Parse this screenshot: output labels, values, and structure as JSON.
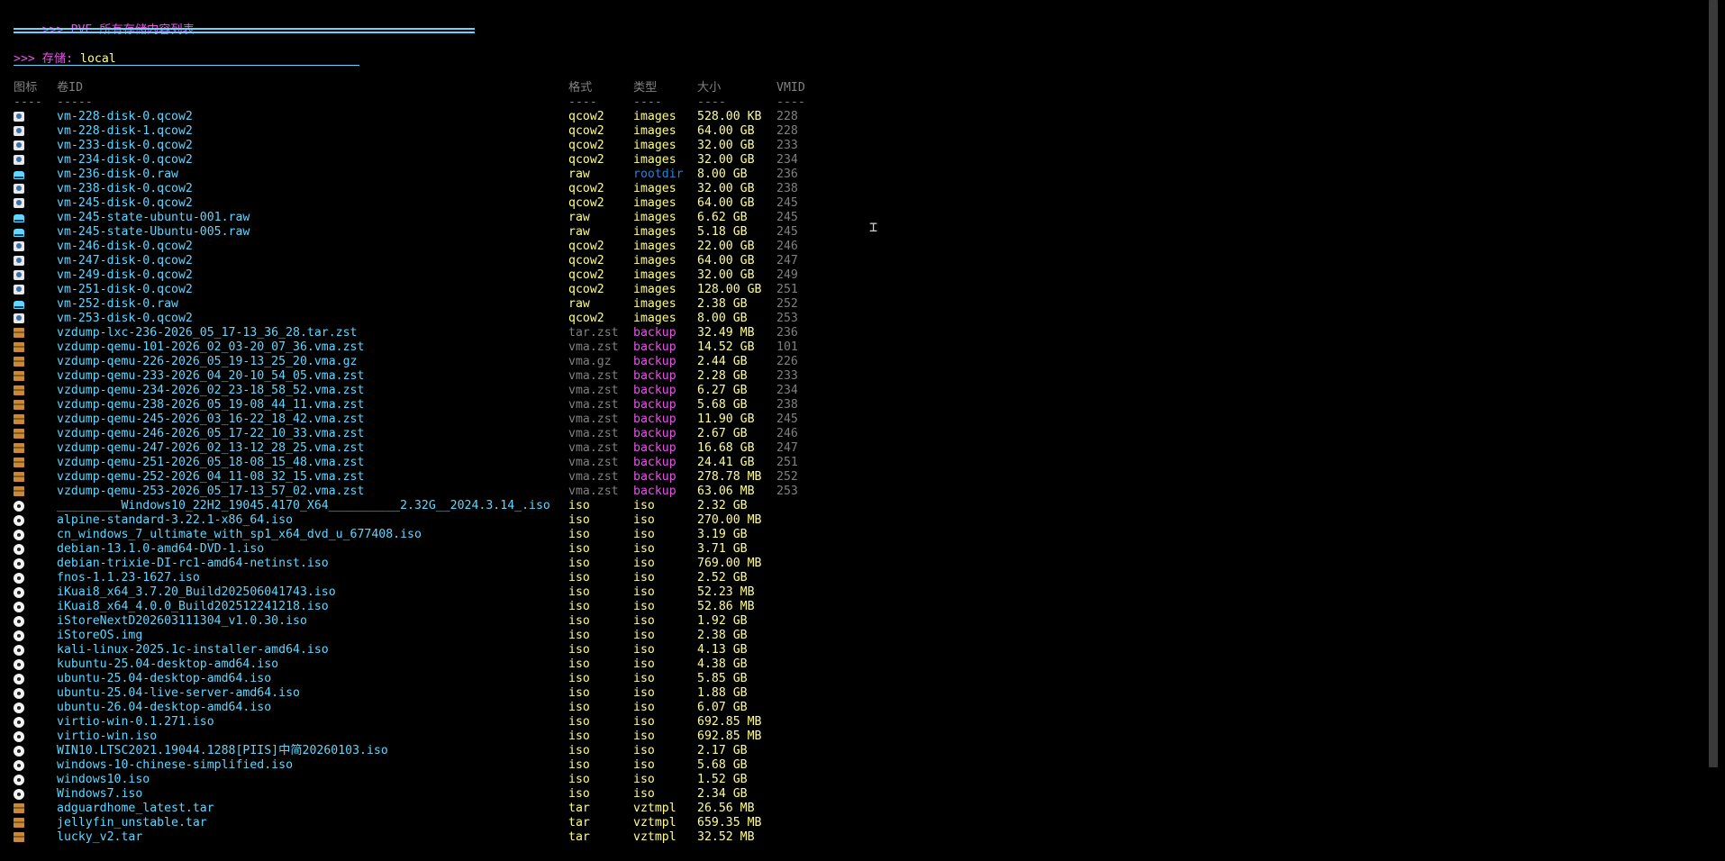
{
  "title": ">>> PVE 所有存储内容列表",
  "separator_long": "===========================================================",
  "storage_heading": ">>> 存储: ",
  "storage_name": "local",
  "columns": {
    "icon": "图标",
    "volid": "卷ID",
    "format": "格式",
    "type": "类型",
    "size": "大小",
    "vmid": "VMID"
  },
  "column_underlines": {
    "icon": "----",
    "volid": "-----",
    "format": "----",
    "type": "----",
    "size": "----",
    "vmid": "----"
  },
  "colors": {
    "magenta": "#e356e3",
    "cyan": "#5fd7ff",
    "yellow": "#ffff87",
    "grey": "#808080",
    "rootdir_blue": "#2f7fd4",
    "background": "#000000"
  },
  "rows": [
    {
      "icon": "disk-icon",
      "volid": "vm-228-disk-0.qcow2",
      "format": "qcow2",
      "type": "images",
      "size": "528.00 KB",
      "vmid": "228"
    },
    {
      "icon": "disk-icon",
      "volid": "vm-228-disk-1.qcow2",
      "format": "qcow2",
      "type": "images",
      "size": "64.00 GB",
      "vmid": "228"
    },
    {
      "icon": "disk-icon",
      "volid": "vm-233-disk-0.qcow2",
      "format": "qcow2",
      "type": "images",
      "size": "32.00 GB",
      "vmid": "233"
    },
    {
      "icon": "disk-icon",
      "volid": "vm-234-disk-0.qcow2",
      "format": "qcow2",
      "type": "images",
      "size": "32.00 GB",
      "vmid": "234"
    },
    {
      "icon": "raw-icon",
      "volid": "vm-236-disk-0.raw",
      "format": "raw",
      "type": "rootdir",
      "size": "8.00 GB",
      "vmid": "236"
    },
    {
      "icon": "disk-icon",
      "volid": "vm-238-disk-0.qcow2",
      "format": "qcow2",
      "type": "images",
      "size": "32.00 GB",
      "vmid": "238"
    },
    {
      "icon": "disk-icon",
      "volid": "vm-245-disk-0.qcow2",
      "format": "qcow2",
      "type": "images",
      "size": "64.00 GB",
      "vmid": "245"
    },
    {
      "icon": "raw-icon",
      "volid": "vm-245-state-ubuntu-001.raw",
      "format": "raw",
      "type": "images",
      "size": "6.62 GB",
      "vmid": "245"
    },
    {
      "icon": "raw-icon",
      "volid": "vm-245-state-Ubuntu-005.raw",
      "format": "raw",
      "type": "images",
      "size": "5.18 GB",
      "vmid": "245"
    },
    {
      "icon": "disk-icon",
      "volid": "vm-246-disk-0.qcow2",
      "format": "qcow2",
      "type": "images",
      "size": "22.00 GB",
      "vmid": "246"
    },
    {
      "icon": "disk-icon",
      "volid": "vm-247-disk-0.qcow2",
      "format": "qcow2",
      "type": "images",
      "size": "64.00 GB",
      "vmid": "247"
    },
    {
      "icon": "disk-icon",
      "volid": "vm-249-disk-0.qcow2",
      "format": "qcow2",
      "type": "images",
      "size": "32.00 GB",
      "vmid": "249"
    },
    {
      "icon": "disk-icon",
      "volid": "vm-251-disk-0.qcow2",
      "format": "qcow2",
      "type": "images",
      "size": "128.00 GB",
      "vmid": "251"
    },
    {
      "icon": "raw-icon",
      "volid": "vm-252-disk-0.raw",
      "format": "raw",
      "type": "images",
      "size": "2.38 GB",
      "vmid": "252"
    },
    {
      "icon": "disk-icon",
      "volid": "vm-253-disk-0.qcow2",
      "format": "qcow2",
      "type": "images",
      "size": "8.00 GB",
      "vmid": "253"
    },
    {
      "icon": "package-icon",
      "volid": "vzdump-lxc-236-2026_05_17-13_36_28.tar.zst",
      "format": "tar.zst",
      "type": "backup",
      "size": "32.49 MB",
      "vmid": "236"
    },
    {
      "icon": "package-icon",
      "volid": "vzdump-qemu-101-2026_02_03-20_07_36.vma.zst",
      "format": "vma.zst",
      "type": "backup",
      "size": "14.52 GB",
      "vmid": "101"
    },
    {
      "icon": "package-icon",
      "volid": "vzdump-qemu-226-2026_05_19-13_25_20.vma.gz",
      "format": "vma.gz",
      "type": "backup",
      "size": "2.44 GB",
      "vmid": "226"
    },
    {
      "icon": "package-icon",
      "volid": "vzdump-qemu-233-2026_04_20-10_54_05.vma.zst",
      "format": "vma.zst",
      "type": "backup",
      "size": "2.28 GB",
      "vmid": "233"
    },
    {
      "icon": "package-icon",
      "volid": "vzdump-qemu-234-2026_02_23-18_58_52.vma.zst",
      "format": "vma.zst",
      "type": "backup",
      "size": "6.27 GB",
      "vmid": "234"
    },
    {
      "icon": "package-icon",
      "volid": "vzdump-qemu-238-2026_05_19-08_44_11.vma.zst",
      "format": "vma.zst",
      "type": "backup",
      "size": "5.68 GB",
      "vmid": "238"
    },
    {
      "icon": "package-icon",
      "volid": "vzdump-qemu-245-2026_03_16-22_18_42.vma.zst",
      "format": "vma.zst",
      "type": "backup",
      "size": "11.90 GB",
      "vmid": "245"
    },
    {
      "icon": "package-icon",
      "volid": "vzdump-qemu-246-2026_05_17-22_10_33.vma.zst",
      "format": "vma.zst",
      "type": "backup",
      "size": "2.67 GB",
      "vmid": "246"
    },
    {
      "icon": "package-icon",
      "volid": "vzdump-qemu-247-2026_02_13-12_28_25.vma.zst",
      "format": "vma.zst",
      "type": "backup",
      "size": "16.68 GB",
      "vmid": "247"
    },
    {
      "icon": "package-icon",
      "volid": "vzdump-qemu-251-2026_05_18-08_15_48.vma.zst",
      "format": "vma.zst",
      "type": "backup",
      "size": "24.41 GB",
      "vmid": "251"
    },
    {
      "icon": "package-icon",
      "volid": "vzdump-qemu-252-2026_04_11-08_32_15.vma.zst",
      "format": "vma.zst",
      "type": "backup",
      "size": "278.78 MB",
      "vmid": "252"
    },
    {
      "icon": "package-icon",
      "volid": "vzdump-qemu-253-2026_05_17-13_57_02.vma.zst",
      "format": "vma.zst",
      "type": "backup",
      "size": "63.06 MB",
      "vmid": "253"
    },
    {
      "icon": "iso-icon",
      "volid": "_________Windows10_22H2_19045.4170_X64__________2.32G__2024.3.14_.iso",
      "format": "iso",
      "type": "iso",
      "size": "2.32 GB",
      "vmid": ""
    },
    {
      "icon": "iso-icon",
      "volid": "alpine-standard-3.22.1-x86_64.iso",
      "format": "iso",
      "type": "iso",
      "size": "270.00 MB",
      "vmid": ""
    },
    {
      "icon": "iso-icon",
      "volid": "cn_windows_7_ultimate_with_sp1_x64_dvd_u_677408.iso",
      "format": "iso",
      "type": "iso",
      "size": "3.19 GB",
      "vmid": ""
    },
    {
      "icon": "iso-icon",
      "volid": "debian-13.1.0-amd64-DVD-1.iso",
      "format": "iso",
      "type": "iso",
      "size": "3.71 GB",
      "vmid": ""
    },
    {
      "icon": "iso-icon",
      "volid": "debian-trixie-DI-rc1-amd64-netinst.iso",
      "format": "iso",
      "type": "iso",
      "size": "769.00 MB",
      "vmid": ""
    },
    {
      "icon": "iso-icon",
      "volid": "fnos-1.1.23-1627.iso",
      "format": "iso",
      "type": "iso",
      "size": "2.52 GB",
      "vmid": ""
    },
    {
      "icon": "iso-icon",
      "volid": "iKuai8_x64_3.7.20_Build202506041743.iso",
      "format": "iso",
      "type": "iso",
      "size": "52.23 MB",
      "vmid": ""
    },
    {
      "icon": "iso-icon",
      "volid": "iKuai8_x64_4.0.0_Build202512241218.iso",
      "format": "iso",
      "type": "iso",
      "size": "52.86 MB",
      "vmid": ""
    },
    {
      "icon": "iso-icon",
      "volid": "iStoreNextD202603111304_v1.0.30.iso",
      "format": "iso",
      "type": "iso",
      "size": "1.92 GB",
      "vmid": ""
    },
    {
      "icon": "iso-icon",
      "volid": "iStoreOS.img",
      "format": "iso",
      "type": "iso",
      "size": "2.38 GB",
      "vmid": ""
    },
    {
      "icon": "iso-icon",
      "volid": "kali-linux-2025.1c-installer-amd64.iso",
      "format": "iso",
      "type": "iso",
      "size": "4.13 GB",
      "vmid": ""
    },
    {
      "icon": "iso-icon",
      "volid": "kubuntu-25.04-desktop-amd64.iso",
      "format": "iso",
      "type": "iso",
      "size": "4.38 GB",
      "vmid": ""
    },
    {
      "icon": "iso-icon",
      "volid": "ubuntu-25.04-desktop-amd64.iso",
      "format": "iso",
      "type": "iso",
      "size": "5.85 GB",
      "vmid": ""
    },
    {
      "icon": "iso-icon",
      "volid": "ubuntu-25.04-live-server-amd64.iso",
      "format": "iso",
      "type": "iso",
      "size": "1.88 GB",
      "vmid": ""
    },
    {
      "icon": "iso-icon",
      "volid": "ubuntu-26.04-desktop-amd64.iso",
      "format": "iso",
      "type": "iso",
      "size": "6.07 GB",
      "vmid": ""
    },
    {
      "icon": "iso-icon",
      "volid": "virtio-win-0.1.271.iso",
      "format": "iso",
      "type": "iso",
      "size": "692.85 MB",
      "vmid": ""
    },
    {
      "icon": "iso-icon",
      "volid": "virtio-win.iso",
      "format": "iso",
      "type": "iso",
      "size": "692.85 MB",
      "vmid": ""
    },
    {
      "icon": "iso-icon",
      "volid": "WIN10.LTSC2021.19044.1288[PIIS]中简20260103.iso",
      "format": "iso",
      "type": "iso",
      "size": "2.17 GB",
      "vmid": ""
    },
    {
      "icon": "iso-icon",
      "volid": "windows-10-chinese-simplified.iso",
      "format": "iso",
      "type": "iso",
      "size": "5.68 GB",
      "vmid": ""
    },
    {
      "icon": "iso-icon",
      "volid": "windows10.iso",
      "format": "iso",
      "type": "iso",
      "size": "1.52 GB",
      "vmid": ""
    },
    {
      "icon": "iso-icon",
      "volid": "Windows7.iso",
      "format": "iso",
      "type": "iso",
      "size": "2.34 GB",
      "vmid": ""
    },
    {
      "icon": "package-icon",
      "volid": "adguardhome_latest.tar",
      "format": "tar",
      "type": "vztmpl",
      "size": "26.56 MB",
      "vmid": ""
    },
    {
      "icon": "package-icon",
      "volid": "jellyfin_unstable.tar",
      "format": "tar",
      "type": "vztmpl",
      "size": "659.35 MB",
      "vmid": ""
    },
    {
      "icon": "package-icon",
      "volid": "lucky_v2.tar",
      "format": "tar",
      "type": "vztmpl",
      "size": "32.52 MB",
      "vmid": ""
    }
  ]
}
